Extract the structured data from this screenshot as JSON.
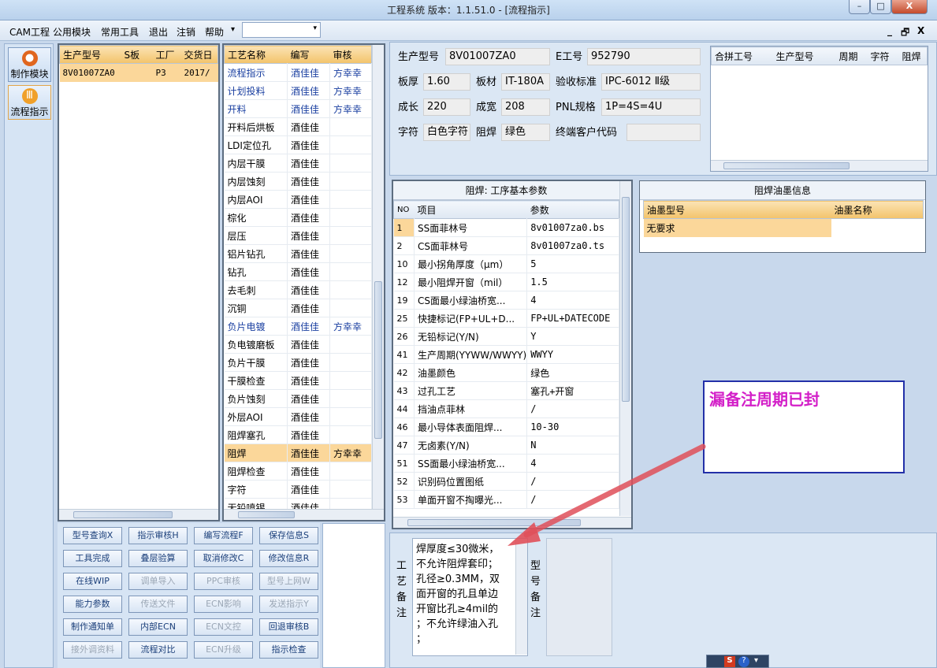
{
  "window": {
    "title": "工程系统   版本：1.1.51.0 - [流程指示]",
    "controls": {
      "minimize": "–",
      "maximize": "□",
      "close": "X"
    }
  },
  "menu": {
    "items": [
      "CAM工程",
      "公用模块",
      "常用工具",
      "退出",
      "注销",
      "帮助"
    ],
    "dropdown_marker": "▾",
    "mdi": [
      "_",
      "🗗",
      "X"
    ]
  },
  "sidebar": {
    "items": [
      {
        "label": "制作模块"
      },
      {
        "label": "流程指示"
      }
    ]
  },
  "orders": {
    "headers": [
      "生产型号",
      "S板",
      "工厂",
      "交货日"
    ],
    "rows": [
      [
        "8V01007ZA0",
        "",
        "P3",
        "2017/"
      ]
    ]
  },
  "process": {
    "headers": [
      "工艺名称",
      "编写",
      "审核"
    ],
    "rows": [
      [
        "流程指示",
        "酒佳佳",
        "方幸幸"
      ],
      [
        "计划投料",
        "酒佳佳",
        "方幸幸"
      ],
      [
        "开料",
        "酒佳佳",
        "方幸幸"
      ],
      [
        "开料后烘板",
        "酒佳佳",
        ""
      ],
      [
        "LDI定位孔",
        "酒佳佳",
        ""
      ],
      [
        "内层干膜",
        "酒佳佳",
        ""
      ],
      [
        "内层蚀刻",
        "酒佳佳",
        ""
      ],
      [
        "内层AOI",
        "酒佳佳",
        ""
      ],
      [
        "棕化",
        "酒佳佳",
        ""
      ],
      [
        "层压",
        "酒佳佳",
        ""
      ],
      [
        "铝片钻孔",
        "酒佳佳",
        ""
      ],
      [
        "钻孔",
        "酒佳佳",
        ""
      ],
      [
        "去毛刺",
        "酒佳佳",
        ""
      ],
      [
        "沉铜",
        "酒佳佳",
        ""
      ],
      [
        "负片电镀",
        "酒佳佳",
        "方幸幸"
      ],
      [
        "负电镀磨板",
        "酒佳佳",
        ""
      ],
      [
        "负片干膜",
        "酒佳佳",
        ""
      ],
      [
        "干膜检查",
        "酒佳佳",
        ""
      ],
      [
        "负片蚀刻",
        "酒佳佳",
        ""
      ],
      [
        "外层AOI",
        "酒佳佳",
        ""
      ],
      [
        "阻焊塞孔",
        "酒佳佳",
        ""
      ],
      [
        "阻焊",
        "酒佳佳",
        "方幸幸"
      ],
      [
        "阻焊检查",
        "酒佳佳",
        ""
      ],
      [
        "字符",
        "酒佳佳",
        ""
      ],
      [
        "无铅喷锡",
        "酒佳佳",
        ""
      ]
    ]
  },
  "info": {
    "labels": {
      "model": "生产型号",
      "eno": "E工号",
      "thick": "板厚",
      "mat": "板材",
      "std": "验收标准",
      "len": "成长",
      "wid": "成宽",
      "pnl": "PNL规格",
      "char": "字符",
      "mask": "阻焊",
      "cust": "终端客户代码"
    },
    "values": {
      "model": "8V01007ZA0",
      "eno": "952790",
      "thick": "1.60",
      "mat": "IT-180A",
      "std": "IPC-6012 Ⅱ级",
      "len": "220",
      "wid": "208",
      "pnl": "1P=4S=4U",
      "char": "白色字符",
      "mask": "绿色",
      "cust": ""
    }
  },
  "merge": {
    "headers": [
      "合拼工号",
      "生产型号",
      "周期",
      "字符",
      "阻焊"
    ]
  },
  "params": {
    "title": "阻焊: 工序基本参数",
    "headers": [
      "NO",
      "项目",
      "参数"
    ],
    "rows": [
      [
        "1",
        "SS面菲林号",
        "8v01007za0.bs"
      ],
      [
        "2",
        "CS面菲林号",
        "8v01007za0.ts"
      ],
      [
        "10",
        "最小拐角厚度（μm）",
        "5"
      ],
      [
        "12",
        "最小阻焊开窗（mil）",
        "1.5"
      ],
      [
        "19",
        "CS面最小绿油桥宽...",
        "4"
      ],
      [
        "25",
        "快捷标记(FP+UL+D...",
        "FP+UL+DATECODE"
      ],
      [
        "26",
        "无铅标记(Y/N)",
        "Y"
      ],
      [
        "41",
        "生产周期(YYWW/WWYY)",
        "WWYY"
      ],
      [
        "42",
        "油墨颜色",
        "绿色"
      ],
      [
        "43",
        "过孔工艺",
        "塞孔+开窗"
      ],
      [
        "44",
        "挡油点菲林",
        "/"
      ],
      [
        "46",
        "最小导体表面阻焊...",
        "10-30"
      ],
      [
        "47",
        "无卤素(Y/N)",
        "N"
      ],
      [
        "51",
        "SS面最小绿油桥宽...",
        "4"
      ],
      [
        "52",
        "识别码位置图纸",
        "/"
      ],
      [
        "53",
        "单面开窗不掏曝光...",
        "/"
      ]
    ]
  },
  "ink": {
    "title": "阻焊油墨信息",
    "headers": [
      "油墨型号",
      "油墨名称"
    ],
    "rows": [
      [
        "无要求",
        ""
      ]
    ]
  },
  "buttons": [
    [
      "型号查询X",
      "指示审核H",
      "编写流程F",
      "保存信息S"
    ],
    [
      "工具完成",
      "叠层验算",
      "取消修改C",
      "修改信息R"
    ],
    [
      "在线WIP",
      "调单导入",
      "PPC审核",
      "型号上网W"
    ],
    [
      "能力参数",
      "传送文件",
      "ECN影响",
      "发送指示Y"
    ],
    [
      "制作通知单",
      "内部ECN",
      "ECN文控",
      "回退审核B"
    ],
    [
      "接外调资料",
      "流程对比",
      "ECN升级",
      "指示检查"
    ]
  ],
  "disabled": [
    [
      false,
      false,
      false,
      false
    ],
    [
      false,
      false,
      false,
      false
    ],
    [
      false,
      true,
      true,
      true
    ],
    [
      false,
      true,
      true,
      true
    ],
    [
      false,
      false,
      true,
      false
    ],
    [
      true,
      false,
      true,
      false
    ]
  ],
  "notes": {
    "process_label": "工艺备注",
    "model_label": "型号备注",
    "text": [
      "焊厚度≤30微米，",
      "不允许阻焊套印；",
      "孔径≥0.3MM，双",
      "面开窗的孔且单边",
      "开窗比孔≥4mil的",
      "；不允许绿油入孔",
      "；"
    ]
  },
  "annotation": {
    "text": "漏备注周期已封"
  },
  "tray": {
    "icons": [
      "S",
      "?",
      "▾"
    ]
  },
  "colors": {
    "accent": "#1a3fa0",
    "selected": "#fbd79a",
    "annotation_text": "#d31fc8",
    "arrow": "#e0505a"
  }
}
